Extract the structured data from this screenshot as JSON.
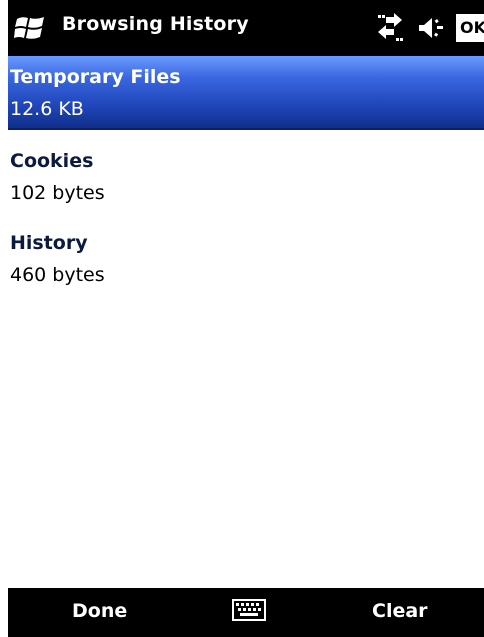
{
  "titlebar": {
    "title": "Browsing History",
    "ok_label": "OK",
    "icons": [
      "windows-start-icon",
      "connectivity-icon",
      "volume-icon"
    ]
  },
  "list": {
    "items": [
      {
        "label": "Temporary Files",
        "value": "12.6 KB",
        "selected": true
      },
      {
        "label": "Cookies",
        "value": "102 bytes",
        "selected": false
      },
      {
        "label": "History",
        "value": "460 bytes",
        "selected": false
      }
    ]
  },
  "softkeys": {
    "left": "Done",
    "right": "Clear",
    "center_icon": "keyboard-icon"
  },
  "colors": {
    "bars": "#000000",
    "selection": "#2a55c9",
    "background": "#ffffff"
  }
}
